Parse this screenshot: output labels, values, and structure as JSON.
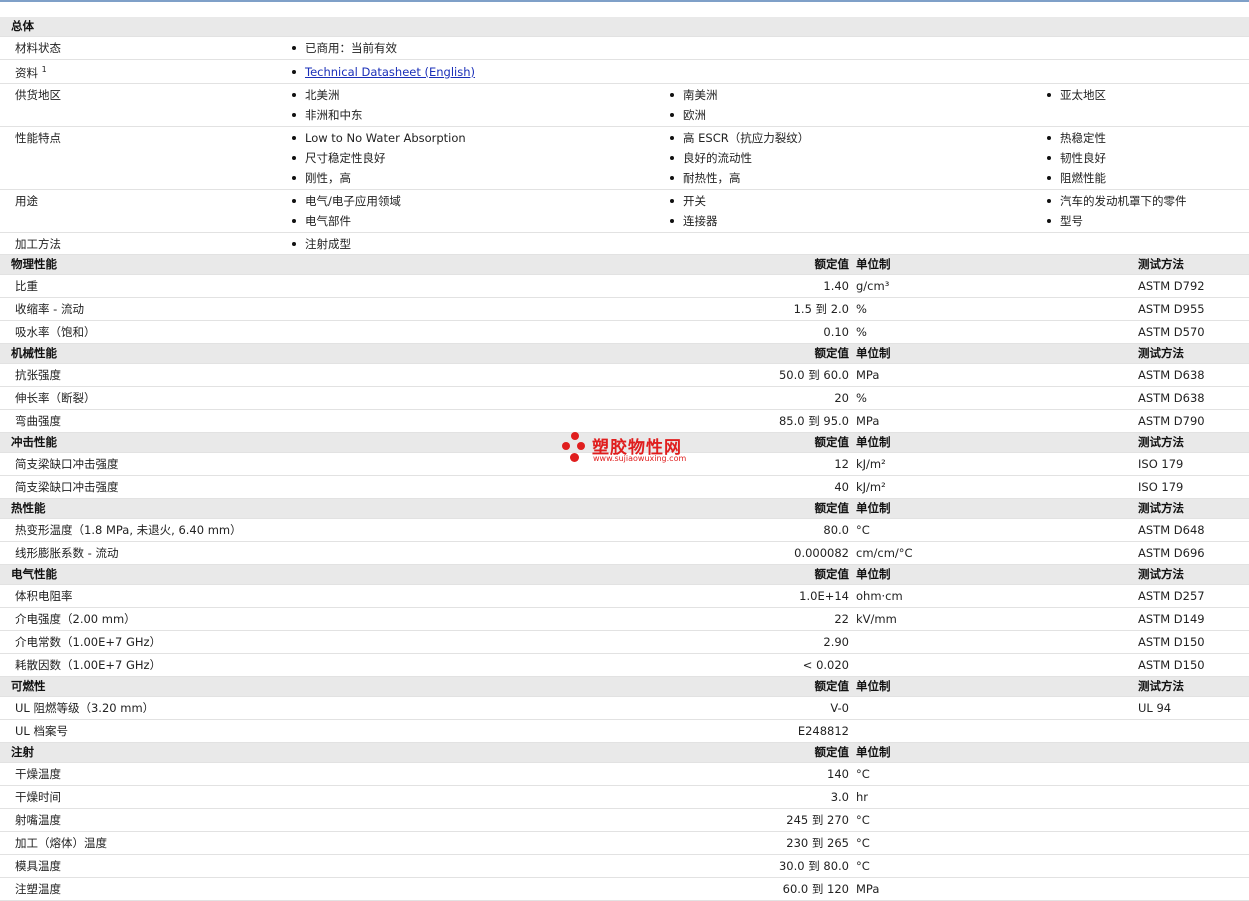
{
  "general": {
    "title": "总体",
    "rows": [
      {
        "label": "材料状态",
        "items": [
          "已商用：当前有效"
        ]
      },
      {
        "label": "资料",
        "sup": "1",
        "items": [
          "Technical Datasheet (English)"
        ]
      },
      {
        "label": "供货地区",
        "items": [
          "北美洲",
          "南美洲",
          "亚太地区",
          "非洲和中东",
          "欧洲"
        ]
      },
      {
        "label": "性能特点",
        "items": [
          "Low to No Water Absorption",
          "高 ESCR（抗应力裂纹）",
          "热稳定性",
          "尺寸稳定性良好",
          "良好的流动性",
          "韧性良好",
          "刚性，高",
          "耐热性，高",
          "阻燃性能"
        ]
      },
      {
        "label": "用途",
        "items": [
          "电气/电子应用领域",
          "开关",
          "汽车的发动机罩下的零件",
          "电气部件",
          "连接器",
          "型号"
        ]
      },
      {
        "label": "加工方法",
        "items": [
          "注射成型"
        ]
      }
    ]
  },
  "headers": {
    "nominal": "额定值",
    "unit": "单位制",
    "method": "测试方法"
  },
  "sections": [
    {
      "title": "物理性能",
      "show_method": true,
      "rows": [
        {
          "p": "比重",
          "v": "1.40",
          "u": "g/cm³",
          "m": "ASTM D792"
        },
        {
          "p": "收缩率 - 流动",
          "v": "1.5 到 2.0",
          "u": "%",
          "m": "ASTM D955"
        },
        {
          "p": "吸水率（饱和）",
          "v": "0.10",
          "u": "%",
          "m": "ASTM D570"
        }
      ]
    },
    {
      "title": "机械性能",
      "show_method": true,
      "rows": [
        {
          "p": "抗张强度",
          "v": "50.0 到 60.0",
          "u": "MPa",
          "m": "ASTM D638"
        },
        {
          "p": "伸长率（断裂）",
          "v": "20",
          "u": "%",
          "m": "ASTM D638"
        },
        {
          "p": "弯曲强度",
          "v": "85.0 到 95.0",
          "u": "MPa",
          "m": "ASTM D790"
        }
      ]
    },
    {
      "title": "冲击性能",
      "show_method": true,
      "rows": [
        {
          "p": "简支梁缺口冲击强度",
          "v": "12",
          "u": "kJ/m²",
          "m": "ISO 179"
        },
        {
          "p": "简支梁缺口冲击强度",
          "v": "40",
          "u": "kJ/m²",
          "m": "ISO 179"
        }
      ]
    },
    {
      "title": "热性能",
      "show_method": true,
      "rows": [
        {
          "p": "热变形温度（1.8 MPa, 未退火, 6.40 mm）",
          "v": "80.0",
          "u": "°C",
          "m": "ASTM D648"
        },
        {
          "p": "线形膨胀系数 - 流动",
          "v": "0.000082",
          "u": "cm/cm/°C",
          "m": "ASTM D696"
        }
      ]
    },
    {
      "title": "电气性能",
      "show_method": true,
      "rows": [
        {
          "p": "体积电阻率",
          "v": "1.0E+14",
          "u": "ohm·cm",
          "m": "ASTM D257"
        },
        {
          "p": "介电强度（2.00 mm）",
          "v": "22",
          "u": "kV/mm",
          "m": "ASTM D149"
        },
        {
          "p": "介电常数（1.00E+7 GHz）",
          "v": "2.90",
          "u": "",
          "m": "ASTM D150"
        },
        {
          "p": "耗散因数（1.00E+7 GHz）",
          "v": "< 0.020",
          "u": "",
          "m": "ASTM D150"
        }
      ]
    },
    {
      "title": "可燃性",
      "show_method": true,
      "rows": [
        {
          "p": "UL 阻燃等级（3.20 mm）",
          "v": "V-0",
          "u": "",
          "m": "UL 94"
        },
        {
          "p": "UL 档案号",
          "v": "E248812",
          "u": "",
          "m": ""
        }
      ]
    },
    {
      "title": "注射",
      "show_method": false,
      "rows": [
        {
          "p": "干燥温度",
          "v": "140",
          "u": "°C",
          "m": ""
        },
        {
          "p": "干燥时间",
          "v": "3.0",
          "u": "hr",
          "m": ""
        },
        {
          "p": "射嘴温度",
          "v": "245 到 270",
          "u": "°C",
          "m": ""
        },
        {
          "p": "加工（熔体）温度",
          "v": "230 到 265",
          "u": "°C",
          "m": ""
        },
        {
          "p": "模具温度",
          "v": "30.0 到 80.0",
          "u": "°C",
          "m": ""
        },
        {
          "p": "注塑温度",
          "v": "60.0 到 120",
          "u": "MPa",
          "m": ""
        }
      ]
    }
  ],
  "watermark": {
    "name": "塑胶物性网",
    "url": "www.sujiaowuxing.com"
  },
  "colors": {
    "header_bg": "#e9e9e9",
    "link": "#1a2fb8",
    "watermark": "#e01e1e"
  }
}
